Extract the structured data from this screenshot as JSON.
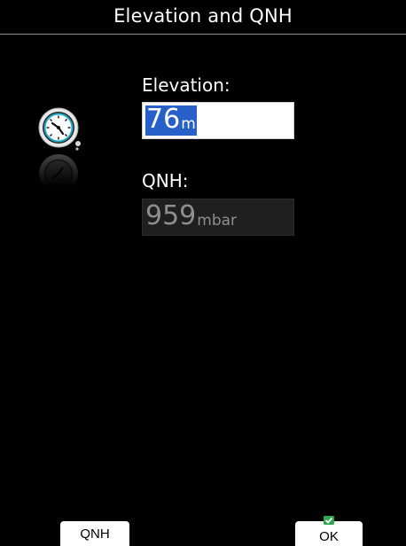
{
  "window": {
    "title": "Elevation and QNH"
  },
  "icon": {
    "name": "altimeter-gauge-icon"
  },
  "fields": {
    "elevation": {
      "label": "Elevation:",
      "value": "76",
      "unit": "m"
    },
    "qnh": {
      "label": "QNH:",
      "value": "959",
      "unit": "mbar"
    }
  },
  "softkeys": {
    "left_label": "QNH",
    "right_label": "OK"
  },
  "colors": {
    "background": "#000000",
    "selection": "#2760c8",
    "ok_check": "#2fa84f"
  }
}
